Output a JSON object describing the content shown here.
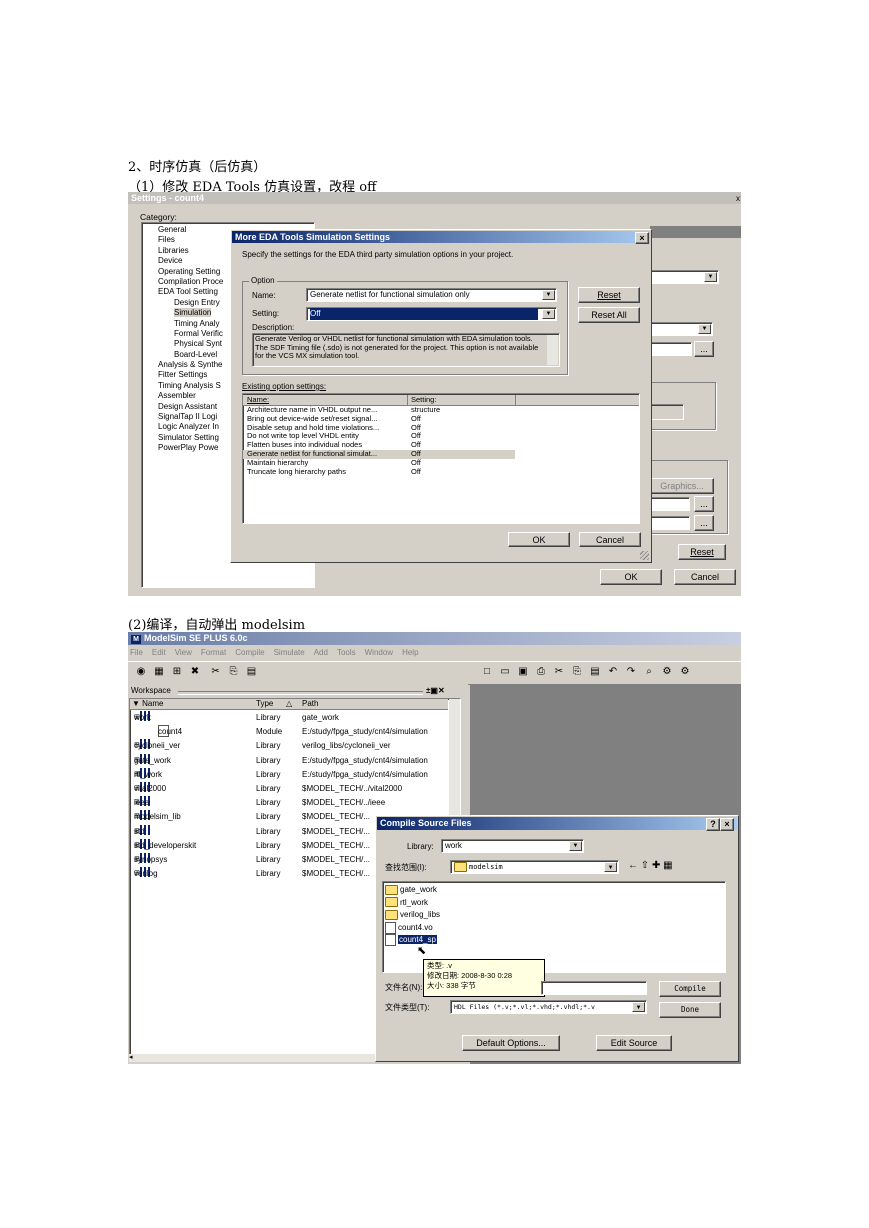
{
  "doc": {
    "heading": "2、时序仿真（后仿真）",
    "step1": "（1）修改 EDA Tools  仿真设置，改程 off",
    "step2": "(2)编译，自动弹出 modelsim"
  },
  "settings": {
    "title": "Settings - count4",
    "category_label": "Category:",
    "tree": [
      "General",
      "Files",
      "Libraries",
      "Device",
      "Operating Setting",
      "Compilation Proce",
      "EDA Tool Setting",
      "Design Entry",
      "Simulation",
      "Timing Analy",
      "Formal Verific",
      "Physical Synt",
      "Board-Level",
      "Analysis & Synthe",
      "Fitter Settings",
      "Timing Analysis S",
      "Assembler",
      "Design Assistant",
      "SignalTap II Logi",
      "Logic Analyzer In",
      "Simulator Setting",
      "PowerPlay Powe"
    ],
    "ellipsis": "...",
    "graphics_btn": "Graphics...",
    "reset_btn": "Reset",
    "ok_btn": "OK",
    "cancel_btn": "Cancel"
  },
  "more_eda": {
    "title": "More EDA Tools Simulation Settings",
    "close_glyph": "×",
    "intro": "Specify the settings for the EDA third party simulation options in your project.",
    "option_group": "Option",
    "name_label": "Name:",
    "name_value": "Generate netlist for functional simulation only",
    "setting_label": "Setting:",
    "setting_value": "Off",
    "description_label": "Description:",
    "description": "Generate Verilog or VHDL netlist for functional simulation with EDA simulation tools. The SDF Timing file (.sdo) is not generated for the project. This option is not available for the VCS MX simulation tool.",
    "reset_btn": "Reset",
    "reset_all_btn": "Reset All",
    "existing_label": "Existing option settings:",
    "col_name": "Name:",
    "col_setting": "Setting:",
    "rows": [
      {
        "name": "Architecture name in VHDL output ne...",
        "setting": "structure"
      },
      {
        "name": "Bring out device-wide set/reset signal...",
        "setting": "Off"
      },
      {
        "name": "Disable setup and hold time violations...",
        "setting": "Off"
      },
      {
        "name": "Do not write top level VHDL entity",
        "setting": "Off"
      },
      {
        "name": "Flatten buses into individual nodes",
        "setting": "Off"
      },
      {
        "name": "Generate netlist for functional simulat...",
        "setting": "Off"
      },
      {
        "name": "Maintain hierarchy",
        "setting": "Off"
      },
      {
        "name": "Truncate long hierarchy paths",
        "setting": "Off"
      }
    ],
    "ok_btn": "OK",
    "cancel_btn": "Cancel"
  },
  "modelsim": {
    "title": "ModelSim SE PLUS 6.0c",
    "menu": [
      "File",
      "Edit",
      "View",
      "Format",
      "Compile",
      "Simulate",
      "Add",
      "Tools",
      "Window",
      "Help"
    ],
    "workspace_label": "Workspace",
    "col_name": "Name",
    "col_type": "Type",
    "col_path": "Path",
    "rows": [
      {
        "name": "work",
        "type": "Library",
        "path": "gate_work",
        "indent": 0,
        "icon": "lib"
      },
      {
        "name": "count4",
        "type": "Module",
        "path": "E:/study/fpga_study/cnt4/simulation",
        "indent": 1,
        "icon": "file"
      },
      {
        "name": "cycloneii_ver",
        "type": "Library",
        "path": "verilog_libs/cycloneii_ver",
        "indent": 0,
        "icon": "lib"
      },
      {
        "name": "gate_work",
        "type": "Library",
        "path": "E:/study/fpga_study/cnt4/simulation",
        "indent": 0,
        "icon": "lib"
      },
      {
        "name": "rtl_work",
        "type": "Library",
        "path": "E:/study/fpga_study/cnt4/simulation",
        "indent": 0,
        "icon": "lib"
      },
      {
        "name": "vital2000",
        "type": "Library",
        "path": "$MODEL_TECH/../vital2000",
        "indent": 0,
        "icon": "lib"
      },
      {
        "name": "ieee",
        "type": "Library",
        "path": "$MODEL_TECH/../ieee",
        "indent": 0,
        "icon": "lib"
      },
      {
        "name": "modelsim_lib",
        "type": "Library",
        "path": "$MODEL_TECH/...",
        "indent": 0,
        "icon": "lib"
      },
      {
        "name": "std",
        "type": "Library",
        "path": "$MODEL_TECH/...",
        "indent": 0,
        "icon": "lib"
      },
      {
        "name": "std_developerskit",
        "type": "Library",
        "path": "$MODEL_TECH/...",
        "indent": 0,
        "icon": "lib"
      },
      {
        "name": "synopsys",
        "type": "Library",
        "path": "$MODEL_TECH/...",
        "indent": 0,
        "icon": "lib"
      },
      {
        "name": "verilog",
        "type": "Library",
        "path": "$MODEL_TECH/...",
        "indent": 0,
        "icon": "lib"
      }
    ]
  },
  "compile": {
    "title": "Compile Source Files",
    "help_glyph": "?",
    "close_glyph": "×",
    "library_label": "Library:",
    "library_value": "work",
    "lookin_label": "查找范围(I):",
    "lookin_value": "modelsim",
    "files": [
      {
        "name": "gate_work",
        "kind": "folder"
      },
      {
        "name": "rtl_work",
        "kind": "folder"
      },
      {
        "name": "verilog_libs",
        "kind": "folder"
      },
      {
        "name": "count4.vo",
        "kind": "file"
      },
      {
        "name": "count4_sp",
        "kind": "file-selected"
      }
    ],
    "tooltip": [
      "类型: .v",
      "修改日期: 2008-8-30 0:28",
      "大小: 338 字节"
    ],
    "filename_label": "文件名(N):",
    "filetype_label": "文件类型(T):",
    "filetype_value": "HDL Files (*.v;*.vl;*.vhd;*.vhdl;*.v",
    "compile_btn": "Compile",
    "done_btn": "Done",
    "default_options_btn": "Default Options...",
    "edit_source_btn": "Edit Source"
  }
}
